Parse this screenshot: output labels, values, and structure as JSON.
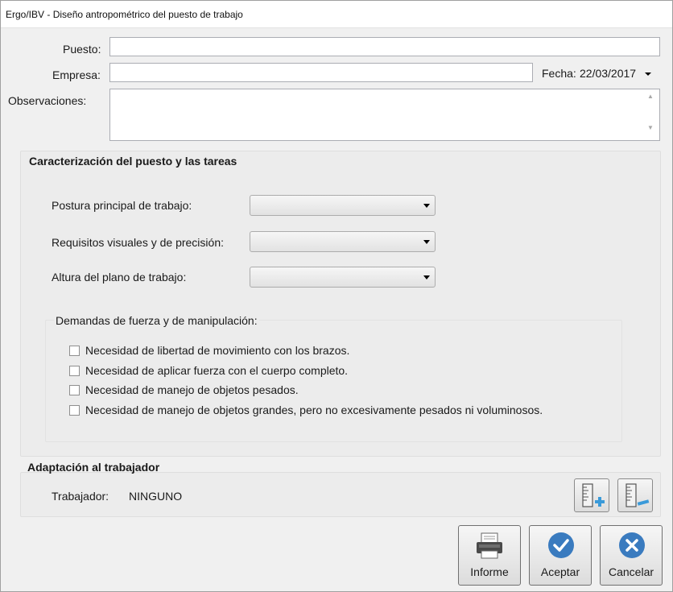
{
  "window": {
    "title": "Ergo/IBV - Diseño antropométrico del puesto de trabajo"
  },
  "form": {
    "puesto_label": "Puesto:",
    "puesto_value": "",
    "empresa_label": "Empresa:",
    "empresa_value": "",
    "fecha_label": "Fecha:",
    "fecha_value": "22/03/2017",
    "observaciones_label": "Observaciones:",
    "observaciones_value": ""
  },
  "caracterizacion": {
    "title": "Caracterización del puesto y las tareas",
    "postura_label": "Postura principal de trabajo:",
    "postura_value": "",
    "requisitos_label": "Requisitos visuales y de precisión:",
    "requisitos_value": "",
    "altura_label": "Altura del plano de trabajo:",
    "altura_value": "",
    "demandas": {
      "title": "Demandas de fuerza y de manipulación:",
      "options": [
        {
          "label": "Necesidad de libertad de movimiento con los brazos.",
          "checked": false
        },
        {
          "label": "Necesidad de aplicar fuerza con el cuerpo completo.",
          "checked": false
        },
        {
          "label": "Necesidad de manejo de objetos pesados.",
          "checked": false
        },
        {
          "label": "Necesidad de manejo de objetos grandes, pero no excesivamente pesados ni voluminosos.",
          "checked": false
        }
      ]
    }
  },
  "adaptacion": {
    "title": "Adaptación al trabajador",
    "trabajador_label": "Trabajador:",
    "trabajador_value": "NINGUNO"
  },
  "buttons": {
    "informe": "Informe",
    "aceptar": "Aceptar",
    "cancelar": "Cancelar"
  },
  "colors": {
    "accent_blue": "#3a7bbf",
    "window_bg": "#f0f0f0",
    "panel_bg": "#ececec"
  },
  "icons": {
    "add_worker": "ruler-plus-icon",
    "remove_worker": "ruler-minus-icon",
    "informe": "printer-icon",
    "aceptar": "checkmark-icon",
    "cancelar": "close-icon"
  }
}
